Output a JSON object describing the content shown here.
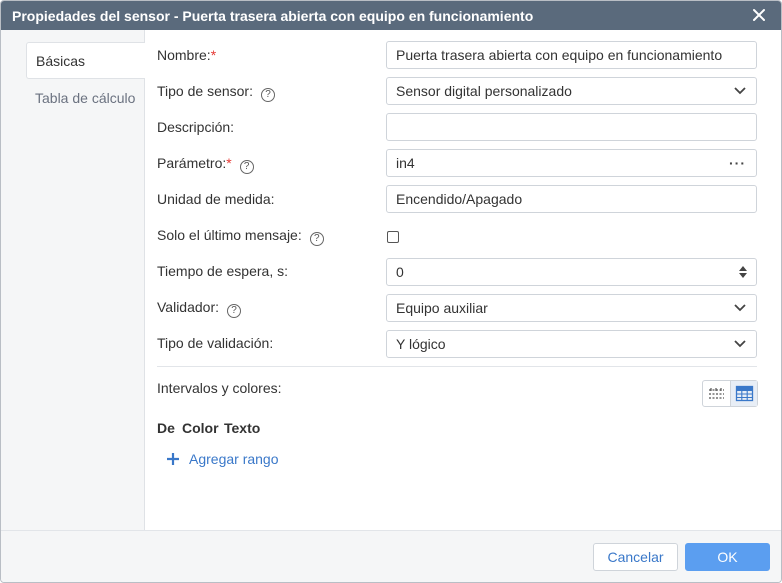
{
  "window": {
    "title": "Propiedades del sensor - Puerta trasera abierta con equipo en funcionamiento"
  },
  "tabs": [
    {
      "label": "Básicas"
    },
    {
      "label": "Tabla de cálculo"
    }
  ],
  "form": {
    "name": {
      "label": "Nombre:",
      "required": "*",
      "value": "Puerta trasera abierta con equipo en funcionamiento"
    },
    "sensor_type": {
      "label": "Tipo de sensor:",
      "value": "Sensor digital personalizado"
    },
    "description": {
      "label": "Descripción:",
      "value": ""
    },
    "parameter": {
      "label": "Parámetro:",
      "required": "*",
      "value": "in4",
      "more": "···"
    },
    "unit": {
      "label": "Unidad de medida:",
      "value": "Encendido/Apagado"
    },
    "last_message_only": {
      "label": "Solo el último mensaje:",
      "checked": false
    },
    "timeout": {
      "label": "Tiempo de espera, s:",
      "value": "0"
    },
    "validator": {
      "label": "Validador:",
      "value": "Equipo auxiliar"
    },
    "validation_type": {
      "label": "Tipo de validación:",
      "value": "Y lógico"
    },
    "help_glyph": "?"
  },
  "intervals": {
    "label": "Intervalos y colores:",
    "columns": [
      "De",
      "Color",
      "Texto"
    ],
    "add_range": "Agregar rango"
  },
  "footer": {
    "cancel": "Cancelar",
    "ok": "OK"
  },
  "colors": {
    "titlebar": "#5a6a7c",
    "accent": "#3a78c9",
    "ok_button": "#5b9ef0",
    "required": "#e53935"
  }
}
